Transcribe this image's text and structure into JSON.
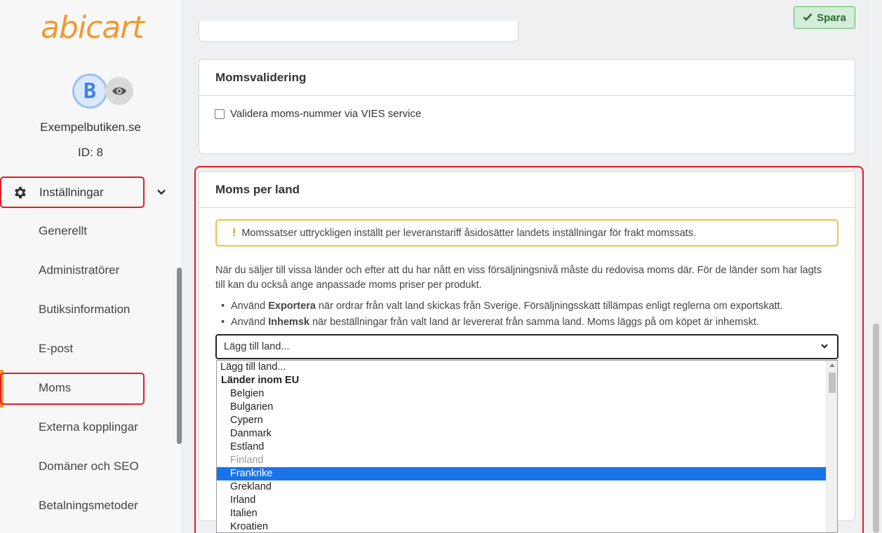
{
  "sidebar": {
    "logo": "abicart",
    "avatar_letter": "B",
    "store_name": "Exempelbutiken.se",
    "store_id": "ID: 8",
    "section_label": "Inställningar",
    "items": [
      {
        "label": "Generellt"
      },
      {
        "label": "Administratörer"
      },
      {
        "label": "Butiksinformation"
      },
      {
        "label": "E-post"
      },
      {
        "label": "Moms"
      },
      {
        "label": "Externa kopplingar"
      },
      {
        "label": "Domäner och SEO"
      },
      {
        "label": "Betalningsmetoder"
      }
    ],
    "active_item": "Moms"
  },
  "toolbar": {
    "save_label": "Spara"
  },
  "vat_validation": {
    "title": "Momsvalidering",
    "checkbox_label": "Validera moms-nummer via VIES service",
    "checked": false
  },
  "vat_per_country": {
    "title": "Moms per land",
    "warning": "Momssatser uttryckligen inställt per leveranstariff åsidosätter landets inställningar för frakt momssats.",
    "description": "När du säljer till vissa länder och efter att du har nått en viss försäljningsnivå måste du redovisa moms där. För de länder som har lagts till kan du också ange anpassade moms priser per produkt.",
    "bullet_export": {
      "prefix": "Använd",
      "keyword": "Exportera",
      "text": "när ordrar från valt land skickas från Sverige. Försäljningsskatt tillämpas enligt reglerna om exportskatt."
    },
    "bullet_domestic": {
      "prefix": "Använd",
      "keyword": "Inhemsk",
      "text": "när beställningar från valt land är levererat från samma land. Moms läggs på om köpet är inhemskt."
    },
    "select_value": "Lägg till land...",
    "dropdown": {
      "placeholder": "Lägg till land...",
      "group_label": "Länder inom EU",
      "options": [
        "Belgien",
        "Bulgarien",
        "Cypern",
        "Danmark",
        "Estland",
        "Finland",
        "Frankrike",
        "Grekland",
        "Irland",
        "Italien",
        "Kroatien"
      ],
      "disabled_option": "Finland",
      "highlighted_option": "Frankrike"
    }
  },
  "colors": {
    "brand_orange": "#f29a2e",
    "highlight_red": "#e01e25",
    "selection_blue": "#1a73e8",
    "warning_yellow": "#f0c040",
    "save_green": "#d4edda"
  }
}
